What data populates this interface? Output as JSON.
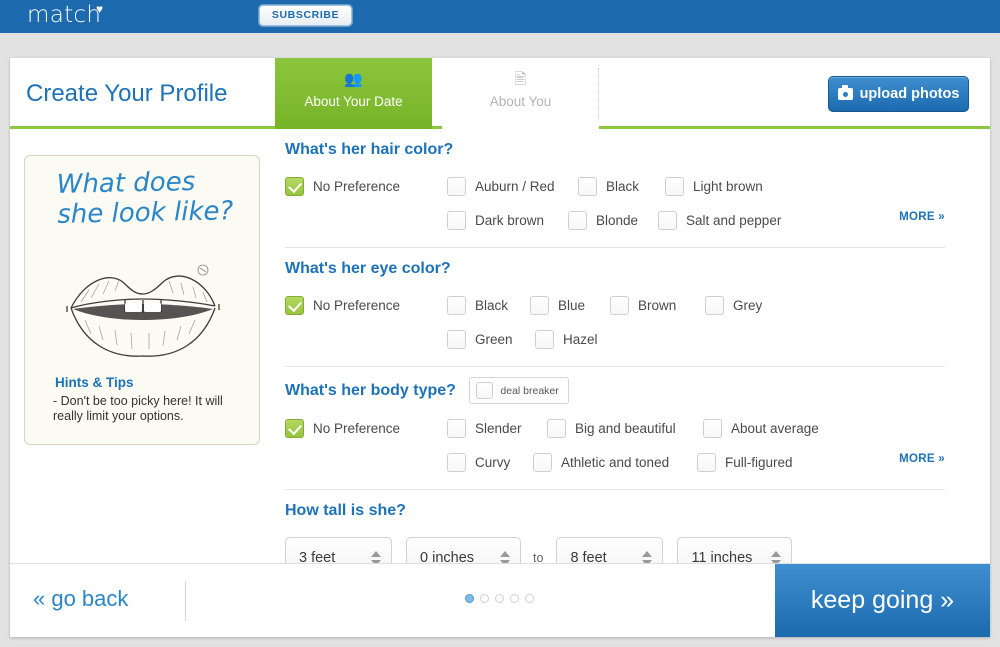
{
  "topbar": {
    "logo_text": "match",
    "logo_icon": "heart-icon",
    "subscribe_label": "SUBSCRIBE"
  },
  "header": {
    "page_title": "Create Your Profile",
    "tabs": [
      {
        "label": "About Your Date",
        "icon": "people-icon",
        "active": true
      },
      {
        "label": "About You",
        "icon": "id-card-icon",
        "active": false
      }
    ],
    "upload_label": "upload photos",
    "upload_icon": "camera-icon",
    "accent_green": "#8cc63e",
    "accent_blue": "#1d72b8"
  },
  "sidebar": {
    "headline": "What does she look like?",
    "illustration": "lips-sketch",
    "hints_heading": "Hints & Tips",
    "hints_text": "- Don't be too picky here! It will really limit your options."
  },
  "questions": [
    {
      "id": "hair-color",
      "title": "What's her hair color?",
      "more_label": "MORE »",
      "has_more": true,
      "deal_breaker": null,
      "rows": [
        [
          {
            "label": "No Preference",
            "checked": true
          },
          {
            "label": "Auburn / Red",
            "checked": false
          },
          {
            "label": "Black",
            "checked": false
          },
          {
            "label": "Light brown",
            "checked": false
          }
        ],
        [
          {
            "label": "Dark brown",
            "checked": false
          },
          {
            "label": "Blonde",
            "checked": false
          },
          {
            "label": "Salt and pepper",
            "checked": false
          }
        ]
      ]
    },
    {
      "id": "eye-color",
      "title": "What's her eye color?",
      "more_label": "",
      "has_more": false,
      "deal_breaker": null,
      "rows": [
        [
          {
            "label": "No Preference",
            "checked": true
          },
          {
            "label": "Black",
            "checked": false
          },
          {
            "label": "Blue",
            "checked": false
          },
          {
            "label": "Brown",
            "checked": false
          },
          {
            "label": "Grey",
            "checked": false
          }
        ],
        [
          {
            "label": "Green",
            "checked": false
          },
          {
            "label": "Hazel",
            "checked": false
          }
        ]
      ]
    },
    {
      "id": "body-type",
      "title": "What's her body type?",
      "more_label": "MORE »",
      "has_more": true,
      "deal_breaker": {
        "label": "deal breaker",
        "checked": false
      },
      "rows": [
        [
          {
            "label": "No Preference",
            "checked": true
          },
          {
            "label": "Slender",
            "checked": false
          },
          {
            "label": "Big and beautiful",
            "checked": false
          },
          {
            "label": "About average",
            "checked": false
          }
        ],
        [
          {
            "label": "Curvy",
            "checked": false
          },
          {
            "label": "Athletic and toned",
            "checked": false
          },
          {
            "label": "Full-figured",
            "checked": false
          }
        ]
      ]
    }
  ],
  "height": {
    "title": "How tall is she?",
    "to_label": "to",
    "min_feet": "3 feet",
    "min_inches": "0 inches",
    "max_feet": "8 feet",
    "max_inches": "11 inches"
  },
  "footer": {
    "go_back_label": "« go back",
    "keep_going_label": "keep going »",
    "dots_total": 5,
    "dots_active_index": 0
  }
}
